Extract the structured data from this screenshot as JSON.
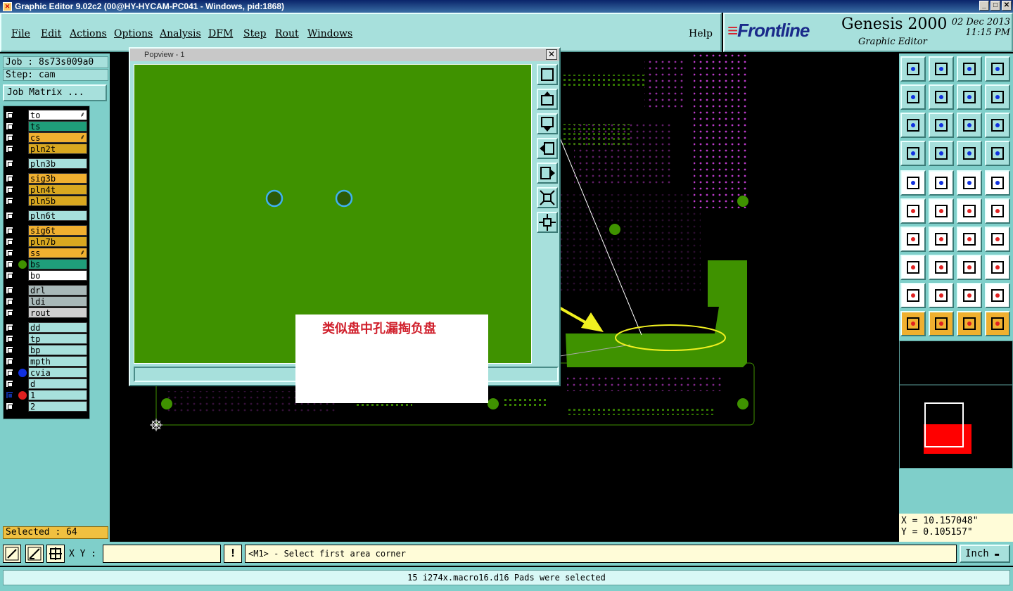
{
  "window": {
    "title": "Graphic Editor 9.02c2 (00@HY-HYCAM-PC041 - Windows, pid:1868)"
  },
  "menu": [
    "File",
    "Edit",
    "Actions",
    "Options",
    "Analysis",
    "DFM",
    "Step",
    "Rout",
    "Windows"
  ],
  "help": "Help",
  "brand": {
    "logo": "Frontline",
    "product": "Genesis 2000",
    "subtitle": "Graphic Editor",
    "date": "02 Dec 2013",
    "time": "11:15 PM"
  },
  "job": {
    "job_label": "Job : 8s73s009a0",
    "step_label": "Step: cam",
    "matrix_button": "Job Matrix ..."
  },
  "layers": [
    {
      "name": "to",
      "color": "#ffffff",
      "flag": "⸙"
    },
    {
      "name": "ts",
      "color": "#1f9e7a"
    },
    {
      "name": "cs",
      "color": "#f0b030",
      "flag": "⸙"
    },
    {
      "name": "pln2t",
      "color": "#d9a820"
    },
    {
      "name": "pln3b",
      "color": "#a7e0dc"
    },
    {
      "name": "sig3b",
      "color": "#f0b030"
    },
    {
      "name": "pln4t",
      "color": "#d9a820"
    },
    {
      "name": "pln5b",
      "color": "#d9a820"
    },
    {
      "name": "pln6t",
      "color": "#a7e0dc"
    },
    {
      "name": "sig6t",
      "color": "#f0b030"
    },
    {
      "name": "pln7b",
      "color": "#d9a820"
    },
    {
      "name": "ss",
      "color": "#f0b030",
      "flag": "⸙"
    },
    {
      "name": "bs",
      "color": "#1f9e7a",
      "dot": "#3f9200"
    },
    {
      "name": "bo",
      "color": "#ffffff"
    },
    {
      "name": "drl",
      "color": "#a8b8b8"
    },
    {
      "name": "ldi",
      "color": "#a8b8b8"
    },
    {
      "name": "rout",
      "color": "#d0d0d0"
    },
    {
      "name": "dd",
      "color": "#a7e0dc"
    },
    {
      "name": "tp",
      "color": "#a7e0dc"
    },
    {
      "name": "bp",
      "color": "#a7e0dc"
    },
    {
      "name": "mpth",
      "color": "#a7e0dc"
    },
    {
      "name": "cvia",
      "color": "#a7e0dc",
      "dot": "#1030e0"
    },
    {
      "name": "d",
      "color": "#a7e0dc"
    },
    {
      "name": "1",
      "color": "#a7e0dc",
      "dot": "#e02020",
      "active": true
    },
    {
      "name": "2",
      "color": "#a7e0dc"
    }
  ],
  "selected": "Selected : 64",
  "popup": {
    "title": "Popview - 1",
    "close": "✕"
  },
  "annotation": "类似盘中孔漏掏负盘",
  "coords": {
    "x": "X = 10.157048\"",
    "y": "Y = 0.105157\""
  },
  "cmd": {
    "xy_label": "X Y :",
    "xy_value": "",
    "prompt": "<M1> - Select first area corner",
    "units": "Inch"
  },
  "status": "15 i274x.macro16.d16 Pads were selected",
  "colors": {
    "panel": "#7fcfca",
    "board_fill": "#3f9200",
    "pad_magenta": "#d040e0",
    "highlight": "#f0f020"
  }
}
